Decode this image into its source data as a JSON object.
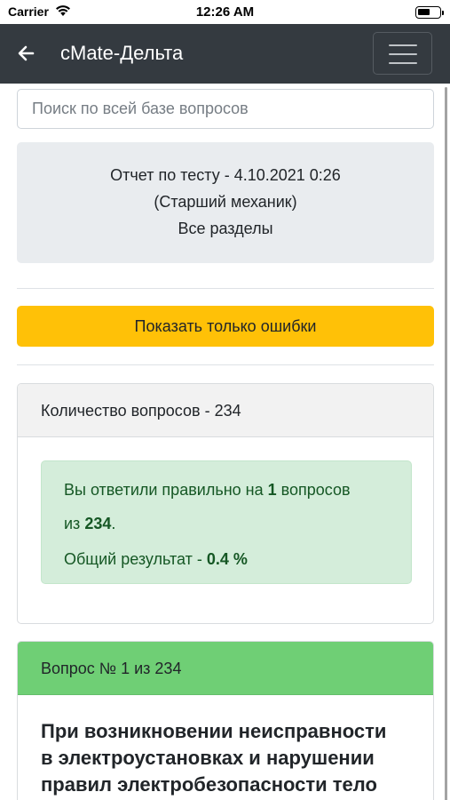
{
  "status_bar": {
    "carrier": "Carrier",
    "time": "12:26 AM"
  },
  "navbar": {
    "title": "cMate-Дельта",
    "back_icon": "arrow-left-icon",
    "menu_icon": "hamburger-menu-icon"
  },
  "search": {
    "placeholder": "Поиск по всей базе вопросов",
    "value": ""
  },
  "report": {
    "line1": "Отчет по тесту - 4.10.2021 0:26",
    "line2": "(Старший механик)",
    "line3": "Все разделы"
  },
  "errors_button": {
    "label": "Показать только ошибки",
    "color": "#ffc107"
  },
  "count_card": {
    "title": "Количество вопросов - 234",
    "alert": {
      "answered_prefix": "Вы ответили правильно на ",
      "correct": "1",
      "answered_suffix": " вопросов",
      "of_prefix": "из ",
      "total": "234",
      "of_suffix": ".",
      "result_prefix": "Общий результат - ",
      "result_value": "0.4 %",
      "color": "#155724",
      "background": "#d4edda"
    }
  },
  "question_card": {
    "number": "Вопрос № 1 из 234",
    "text_line1": "При возникновении неисправности",
    "text_line2": "в электроустановках и нарушении",
    "text_line3": "правил электробезопасности тело",
    "header_color": "#6fcf75"
  },
  "colors": {
    "navbar": "#343a40",
    "report_bg": "#e9ecef"
  }
}
